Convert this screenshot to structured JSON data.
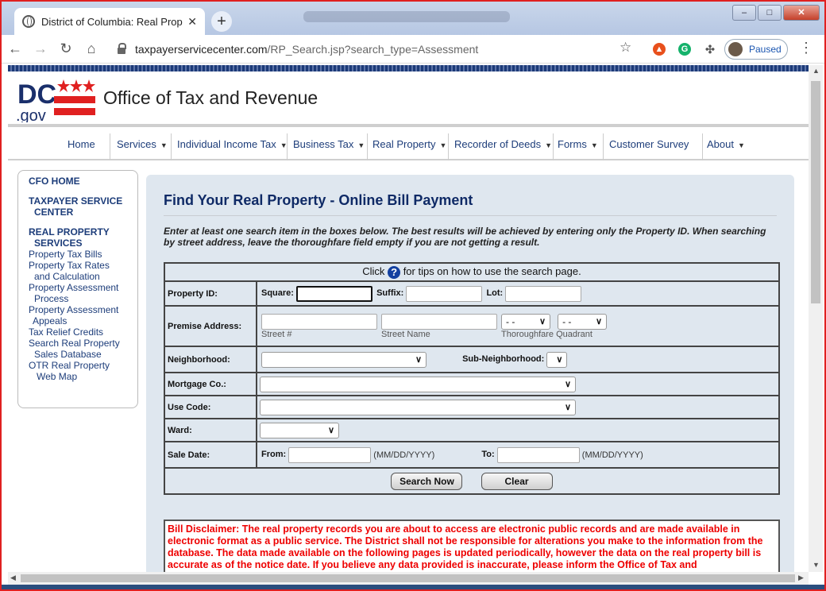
{
  "browser": {
    "tab_title": "District of Columbia: Real Proper",
    "tab_close": "✕",
    "new_tab": "+",
    "url_host": "taxpayerservicecenter.com",
    "url_path": "/RP_Search.jsp?search_type=Assessment",
    "profile_status": "Paused"
  },
  "site": {
    "logo_dc": "DC",
    "logo_gov": ".gov",
    "title": "Office of Tax and Revenue"
  },
  "nav": [
    {
      "label": "Home"
    },
    {
      "label": "Services"
    },
    {
      "label": "Individual Income Tax"
    },
    {
      "label": "Business Tax"
    },
    {
      "label": "Real Property"
    },
    {
      "label": "Recorder of Deeds"
    },
    {
      "label": "Forms"
    },
    {
      "label": "Customer Survey"
    },
    {
      "label": "About"
    }
  ],
  "sidebar": {
    "cfo_home": "CFO HOME",
    "taxpayer_1": "TAXPAYER SERVICE",
    "taxpayer_2": "CENTER",
    "realprop_1": "REAL PROPERTY",
    "realprop_2": "SERVICES",
    "links": [
      "Property Tax Bills",
      "Property Tax Rates",
      "and Calculation",
      "Property Assessment",
      "Process",
      "Property Assessment",
      "Appeals",
      "Tax Relief Credits",
      "Search Real Property",
      "Sales Database",
      "OTR Real Property",
      "Web Map"
    ]
  },
  "main": {
    "heading": "Find Your Real Property - Online Bill Payment",
    "instructions": "Enter at least one search item in the boxes below. The best results will be achieved by entering only the Property ID. When searching by street address, leave the thoroughfare field empty if you are not getting a result.",
    "tips_pre": "Click",
    "tips_post": "for tips on how to use the search page.",
    "form": {
      "property_id": "Property ID:",
      "square": "Square:",
      "suffix": "Suffix:",
      "lot": "Lot:",
      "premise_address": "Premise Address:",
      "street_no": "Street #",
      "street_name": "Street Name",
      "thoroughfare": "Thoroughfare",
      "quadrant": "Quadrant",
      "thoroughfare_value": "- -",
      "quadrant_value": "- -",
      "neighborhood": "Neighborhood:",
      "sub_neighborhood": "Sub-Neighborhood:",
      "mortgage": "Mortgage Co.:",
      "use_code": "Use Code:",
      "ward": "Ward:",
      "sale_date": "Sale Date:",
      "from": "From:",
      "to": "To:",
      "date_hint": "(MM/DD/YYYY)",
      "search_button": "Search Now",
      "clear_button": "Clear"
    },
    "disclaimer": "Bill Disclaimer: The real property records you are about to access are electronic public records and are made available in electronic format as a public service. The District shall not be responsible for alterations you make to the information from the database. The data made available on the following pages is updated periodically, however the data on the real property bill is accurate as of the notice date. If you believe any data provided is inaccurate, please inform the Office of Tax and"
  },
  "colors": {
    "brand_red": "#e02020",
    "nav_blue": "#1d3d7a",
    "content_bg": "#dfe7ef"
  }
}
